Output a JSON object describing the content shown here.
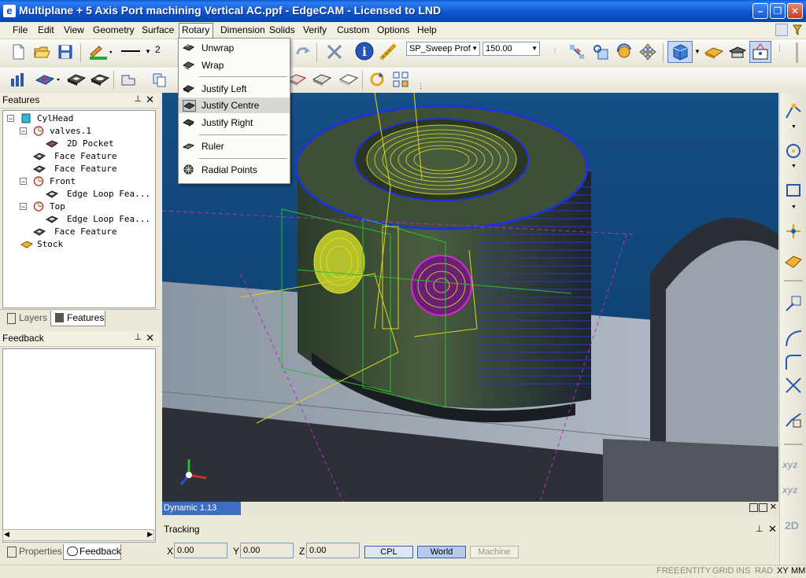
{
  "window": {
    "title": "Multiplane + 5 Axis Port machining Vertical AC.ppf - EdgeCAM - Licensed to LND"
  },
  "menubar": {
    "items": [
      "File",
      "Edit",
      "View",
      "Geometry",
      "Surface",
      "Rotary",
      "Dimension",
      "Solids",
      "Verify",
      "Custom",
      "Options",
      "Help"
    ],
    "open": "Rotary"
  },
  "toolbar": {
    "line_width": "2",
    "sweep_combo": "SP_Sweep Prof",
    "value_combo": "150.00"
  },
  "rotary_menu": {
    "items": [
      {
        "label": "Unwrap",
        "icon": "unwrap-icon"
      },
      {
        "label": "Wrap",
        "icon": "wrap-icon"
      },
      {
        "label": "Justify Left",
        "icon": "justify-left-icon"
      },
      {
        "label": "Justify Centre",
        "icon": "justify-centre-icon"
      },
      {
        "label": "Justify Right",
        "icon": "justify-right-icon"
      },
      {
        "label": "Ruler",
        "icon": "ruler-icon"
      },
      {
        "label": "Radial Points",
        "icon": "radial-points-icon"
      }
    ]
  },
  "features_panel": {
    "title": "Features",
    "tree": [
      {
        "label": "CylHead",
        "level": 0,
        "icon": "part-icon",
        "expander": "⊟"
      },
      {
        "label": "valves.1",
        "level": 1,
        "icon": "cpl-icon",
        "expander": "⊟"
      },
      {
        "label": "2D Pocket",
        "level": 2,
        "icon": "pocket-icon"
      },
      {
        "label": "Face Feature",
        "level": 1,
        "icon": "face-feature-icon"
      },
      {
        "label": "Face Feature",
        "level": 1,
        "icon": "face-feature-icon"
      },
      {
        "label": "Front",
        "level": 1,
        "icon": "cpl-icon",
        "expander": "⊟"
      },
      {
        "label": "Edge Loop Fea...",
        "level": 2,
        "icon": "edge-loop-icon"
      },
      {
        "label": "Top",
        "level": 1,
        "icon": "cpl-icon",
        "expander": "⊟"
      },
      {
        "label": "Edge Loop Fea...",
        "level": 2,
        "icon": "edge-loop-icon"
      },
      {
        "label": "Face Feature",
        "level": 1,
        "icon": "face-feature-icon"
      },
      {
        "label": "Stock",
        "level": 0,
        "icon": "stock-icon"
      }
    ],
    "tabs": [
      "Layers",
      "Features"
    ]
  },
  "feedback_panel": {
    "title": "Feedback",
    "tabs": [
      "Properties",
      "Feedback"
    ]
  },
  "viewport": {
    "status": "Dynamic 1.13"
  },
  "tracking": {
    "title": "Tracking",
    "x_label": "X",
    "x_value": "0.00",
    "y_label": "Y",
    "y_value": "0.00",
    "z_label": "Z",
    "z_value": "0.00",
    "buttons": [
      "CPL",
      "World",
      "Machine"
    ]
  },
  "statusbar": {
    "items": [
      "FREE",
      "ENTITY",
      "GRID",
      "INS",
      "RAD",
      "XY",
      "MM"
    ]
  },
  "right_toolbar": {
    "xyz1": "xyz",
    "xyz2": "xyz",
    "mode2d": "2D"
  }
}
